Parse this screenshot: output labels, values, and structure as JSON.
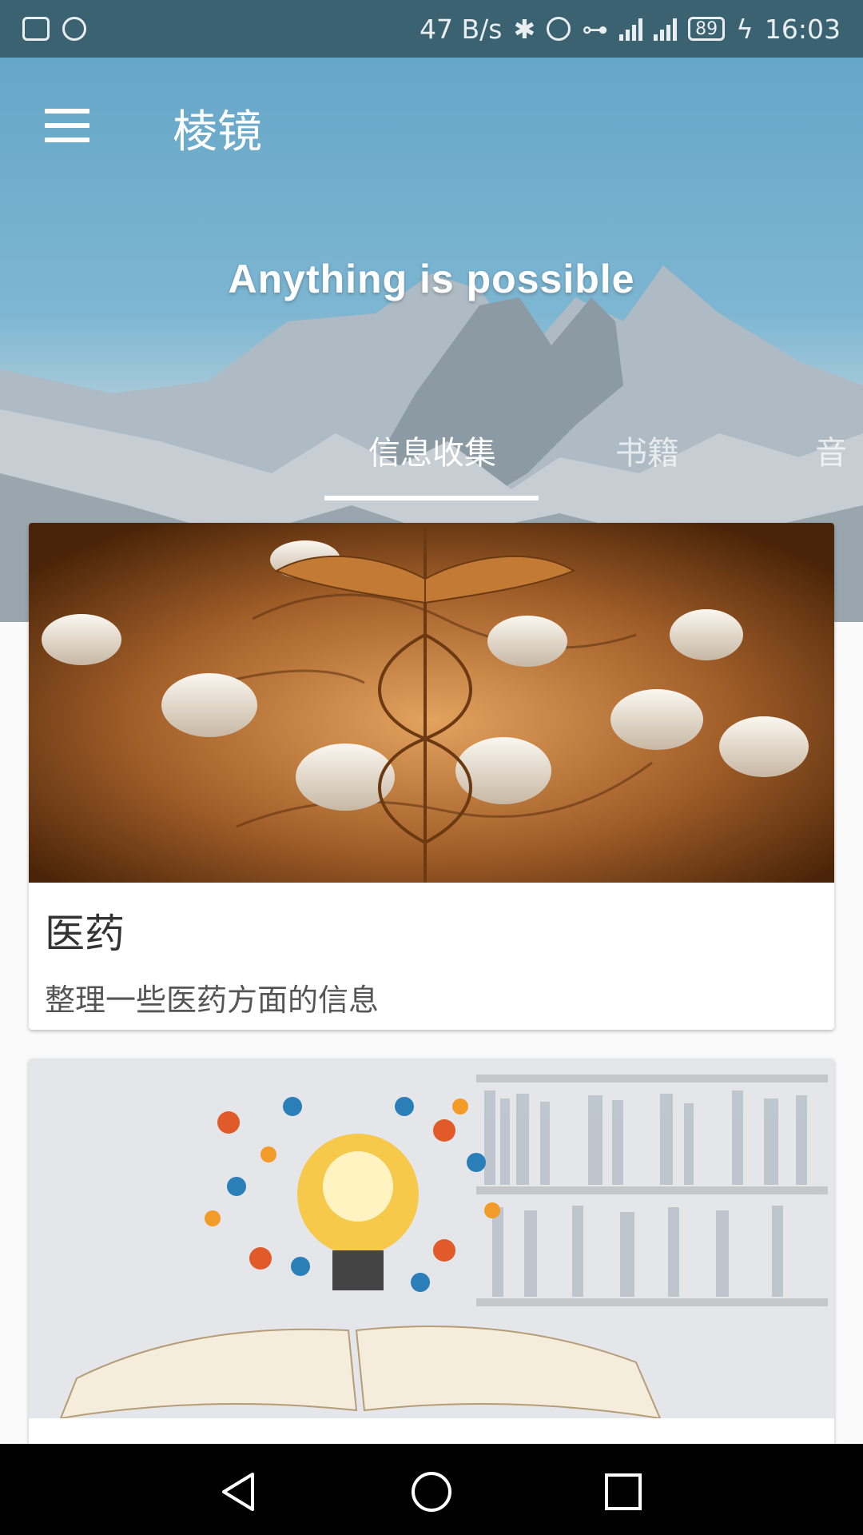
{
  "status_bar": {
    "net_speed": "47 B/s",
    "battery": "89",
    "time": "16:03",
    "icons": [
      "activity-icon",
      "shield-icon",
      "bluetooth-icon",
      "alarm-icon",
      "key-icon",
      "signal-4g-icon",
      "signal-4g-2g-icon",
      "battery-icon",
      "charging-icon"
    ]
  },
  "toolbar": {
    "title": "棱镜",
    "menu_icon": "hamburger-menu-icon"
  },
  "banner": {
    "slogan": "Anything is possible"
  },
  "tabs": [
    {
      "label": "信息收集",
      "active": true
    },
    {
      "label": "书籍",
      "active": false
    },
    {
      "label": "音",
      "active": false
    }
  ],
  "cards": [
    {
      "title": "医药",
      "description": "整理一些医药方面的信息",
      "image": "medicine-pills-caduceus-image"
    },
    {
      "title": "",
      "description": "",
      "image": "lightbulb-book-education-image"
    }
  ],
  "navigation": {
    "back_icon": "back-triangle-icon",
    "home_icon": "home-circle-icon",
    "recent_icon": "recent-square-icon"
  },
  "colors": {
    "status_bar": "#3b6271",
    "header_sky": "#66a6c8",
    "mountain": "#8e9aa3"
  }
}
